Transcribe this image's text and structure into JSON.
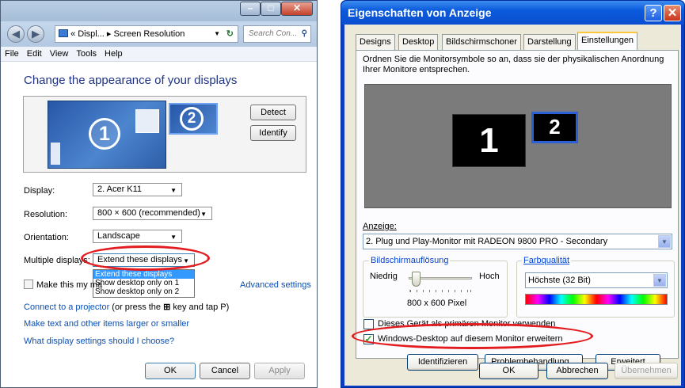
{
  "win7": {
    "address": "« Displ... ▸ Screen Resolution",
    "search_placeholder": "Search Con...",
    "menu": [
      "File",
      "Edit",
      "View",
      "Tools",
      "Help"
    ],
    "heading": "Change the appearance of your displays",
    "monitor1": "1",
    "monitor2": "2",
    "detect": "Detect",
    "identify": "Identify",
    "display_label": "Display:",
    "display_value": "2. Acer K11",
    "resolution_label": "Resolution:",
    "resolution_value": "800 × 600 (recommended)",
    "orientation_label": "Orientation:",
    "orientation_value": "Landscape",
    "multiple_label": "Multiple displays:",
    "multiple_value": "Extend these displays",
    "dropdown_options": [
      "Extend these displays",
      "Show desktop only on 1",
      "Show desktop only on 2"
    ],
    "make_main": "Make this my ma",
    "advanced_settings": "Advanced settings",
    "projector_link": "Connect to a projector",
    "projector_hint_a": " (or press the ",
    "projector_hint_b": " key and tap P)",
    "text_larger_link": "Make text and other items larger or smaller",
    "which_settings_link": "What display settings should I choose?",
    "ok": "OK",
    "cancel": "Cancel",
    "apply": "Apply"
  },
  "xp": {
    "title": "Eigenschaften von Anzeige",
    "tabs": [
      "Designs",
      "Desktop",
      "Bildschirmschoner",
      "Darstellung",
      "Einstellungen"
    ],
    "instructions": "Ordnen Sie die Monitorsymbole so an, dass sie der physikalischen Anordnung Ihrer Monitore entsprechen.",
    "monitor1": "1",
    "monitor2": "2",
    "display_label": "Anzeige:",
    "display_value": "2. Plug und Play-Monitor mit RADEON 9800 PRO - Secondary",
    "resolution_group": "Bildschirmauflösung",
    "low": "Niedrig",
    "high": "Hoch",
    "resolution_value": "800 x 600 Pixel",
    "color_group": "Farbqualität",
    "color_value": "Höchste (32 Bit)",
    "primary_checkbox": "Dieses Gerät als primären Monitor verwenden",
    "extend_checkbox": "Windows-Desktop auf diesem Monitor erweitern",
    "identify": "Identifizieren",
    "troubleshoot": "Problembehandlung...",
    "advanced": "Erweitert",
    "ok": "OK",
    "cancel": "Abbrechen",
    "apply": "Übernehmen",
    "extend_checked": true,
    "slider_level_percent": 10
  },
  "colors": {
    "highlight": "#e31c20",
    "win7_link": "#0b4fb3",
    "xp_title": "#0a4ed0"
  }
}
